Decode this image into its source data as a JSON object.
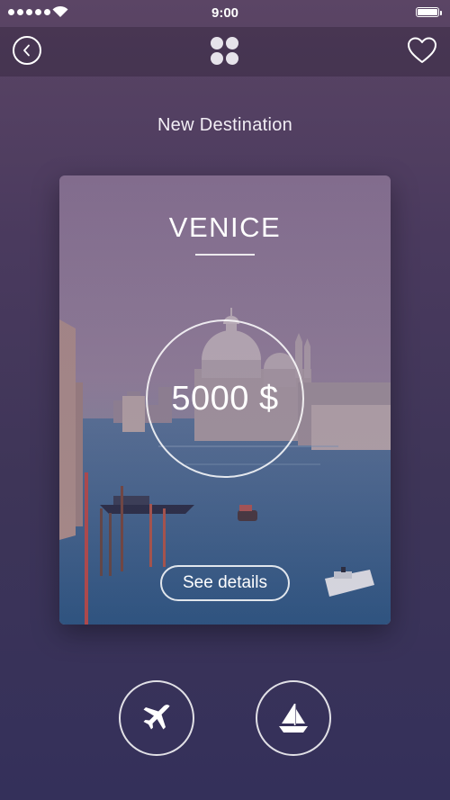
{
  "status_bar": {
    "time": "9:00"
  },
  "nav": {
    "back_icon": "chevron-left-icon",
    "menu_icon": "four-dots-grid-icon",
    "favorite_icon": "heart-icon"
  },
  "section_title": "New Destination",
  "card": {
    "city": "VENICE",
    "price": "5000 $",
    "details_label": "See details"
  },
  "transport": {
    "flight_icon": "airplane-icon",
    "boat_icon": "sailboat-icon"
  },
  "colors": {
    "background_top": "#5b4565",
    "background_bottom": "#34305a",
    "accent": "#ffffff"
  }
}
